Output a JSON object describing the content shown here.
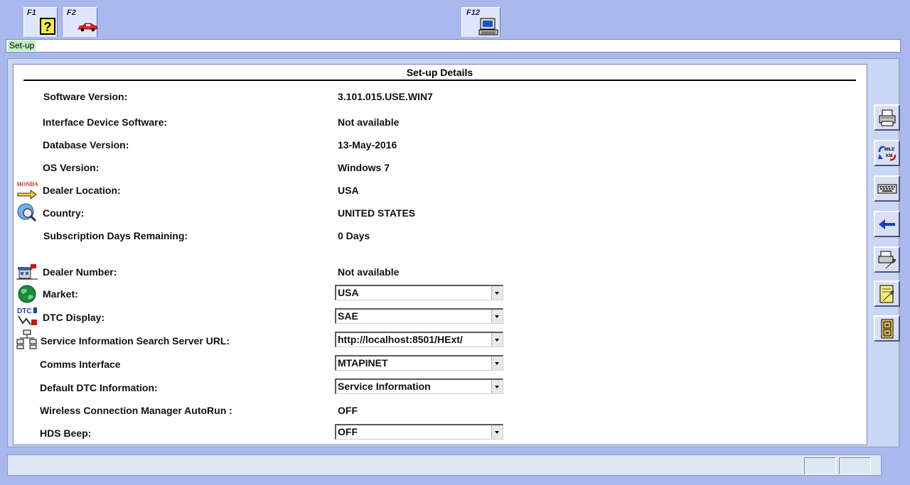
{
  "function_keys": [
    {
      "key": "F1",
      "icon": "help-icon"
    },
    {
      "key": "F2",
      "icon": "car-icon"
    },
    {
      "key": "F12",
      "icon": "computer-icon"
    }
  ],
  "window_title": "Set-up",
  "panel_title": "Set-up Details",
  "info_rows": [
    {
      "label": "Software Version:",
      "value": "3.101.015.USE.WIN7"
    },
    {
      "label": "Interface Device Software:",
      "value": "Not available"
    },
    {
      "label": "Database Version:",
      "value": "13-May-2016"
    },
    {
      "label": "OS Version:",
      "value": "Windows 7"
    },
    {
      "label": "Dealer Location:",
      "value": "USA",
      "icon": "honda-dealer-icon"
    },
    {
      "label": "Country:",
      "value": "UNITED STATES",
      "icon": "globe-magnifier-icon"
    },
    {
      "label": "Subscription Days Remaining:",
      "value": "0 Days"
    },
    {
      "label": "Dealer Number:",
      "value": "Not available",
      "icon": "dealer-building-icon"
    }
  ],
  "settings": [
    {
      "label": "Market:",
      "value": "USA",
      "icon": "earth-icon",
      "type": "select"
    },
    {
      "label": "DTC Display:",
      "value": "SAE",
      "icon": "dtc-icon",
      "type": "select"
    },
    {
      "label": "Service Information Search Server URL:",
      "value": "http://localhost:8501/HExt/",
      "icon": "network-tree-icon",
      "type": "select"
    },
    {
      "label": "Comms Interface",
      "value": "MTAPINET",
      "type": "select"
    },
    {
      "label": "Default DTC Information:",
      "value": "Service Information",
      "type": "select"
    },
    {
      "label": "Wireless Connection Manager AutoRun :",
      "value": "OFF",
      "type": "text"
    },
    {
      "label": "HDS Beep:",
      "value": "OFF",
      "type": "select"
    }
  ],
  "toolbar": [
    "printer-icon",
    "mile-km-toggle-icon",
    "keyboard-icon",
    "back-arrow-icon",
    "print-settings-icon",
    "notes-wrench-icon",
    "file-cabinet-icon"
  ],
  "colors": {
    "background": "#a9b9ee",
    "title_highlight": "#bff0c4",
    "panel": "#ffffff"
  }
}
